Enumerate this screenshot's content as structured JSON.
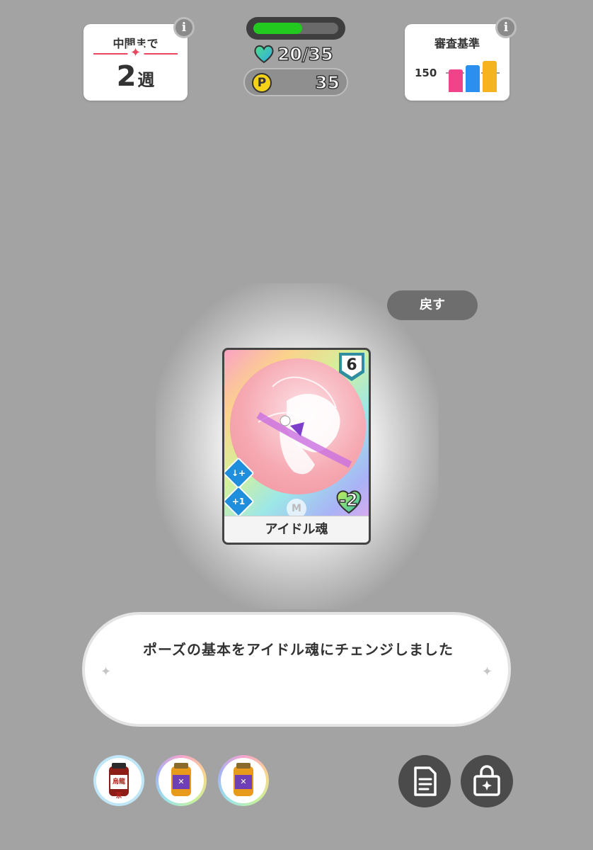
{
  "weeks_panel": {
    "label": "中間まで",
    "value": "2",
    "unit": "週",
    "info_icon": "i"
  },
  "exam_panel": {
    "label": "審査基準",
    "value": "150",
    "info_icon": "i",
    "bar_colors": [
      "#f0438a",
      "#2b8ff0",
      "#f5b31f"
    ]
  },
  "stamina": {
    "current_text": "20/35",
    "current": 20,
    "max": 35,
    "bar_color": "#22c91f"
  },
  "points": {
    "icon_letter": "P",
    "value": "35"
  },
  "back_button": {
    "label": "戻す"
  },
  "card": {
    "name": "アイドル魂",
    "cost": "6",
    "stamina_cost": "-2",
    "rarity_mark": "M",
    "skill_icons": [
      "arrow-plus-icon",
      "plus-one-icon"
    ],
    "skill_second_text": "+1"
  },
  "message": {
    "text": "ポーズの基本をアイドル魂にチェンジしました"
  },
  "drinks": [
    {
      "name": "oolong-tea-drink",
      "label": "烏龍茶"
    },
    {
      "name": "vitamin-drink-1",
      "label": "✕"
    },
    {
      "name": "vitamin-drink-2",
      "label": "✕"
    }
  ],
  "buttons": [
    {
      "name": "deck-list-button",
      "icon": "document-icon"
    },
    {
      "name": "items-bag-button",
      "icon": "bag-icon"
    }
  ]
}
